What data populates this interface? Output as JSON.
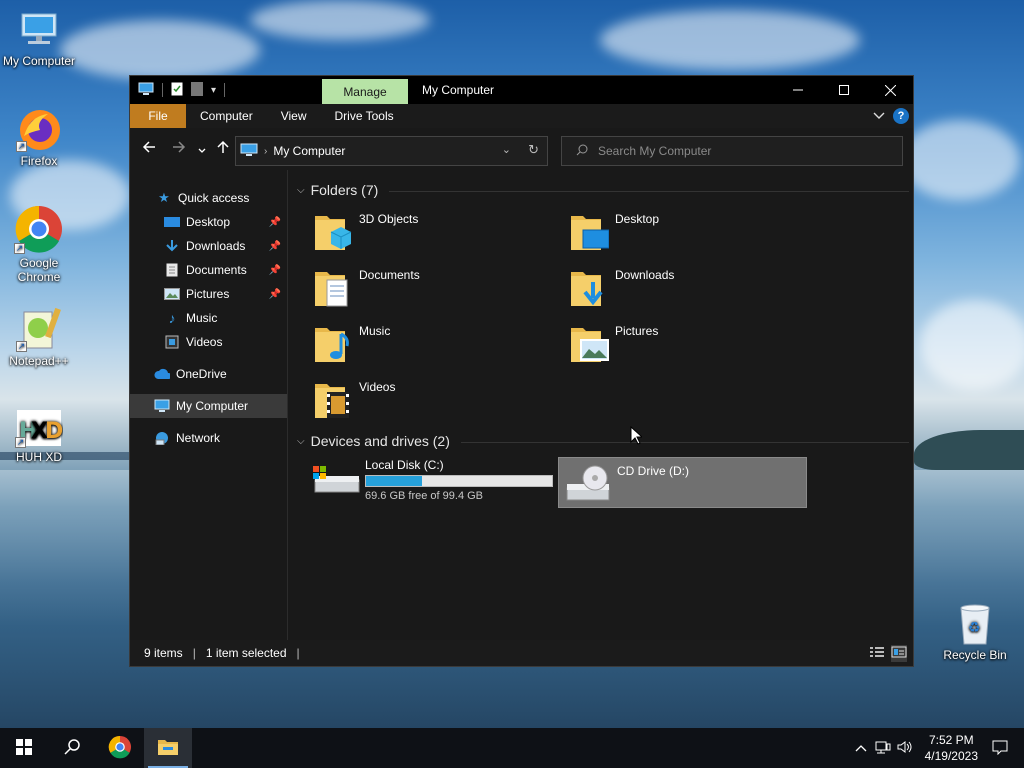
{
  "desktop": {
    "icons": [
      {
        "label": "My Computer"
      },
      {
        "label": "Firefox"
      },
      {
        "label": "Google Chrome"
      },
      {
        "label": "Notepad++"
      },
      {
        "label": "HUH XD"
      },
      {
        "label": "Recycle Bin"
      }
    ]
  },
  "window": {
    "title": "My Computer",
    "manage_tab": "Manage",
    "ribbon_tabs": [
      "File",
      "Computer",
      "View",
      "Drive Tools"
    ],
    "address": "My Computer",
    "search_placeholder": "Search My Computer",
    "controls": {
      "minimize": "—",
      "maximize": "☐",
      "close": "✕"
    }
  },
  "sidebar": {
    "items": [
      {
        "label": "Quick access",
        "icon": "star-icon"
      },
      {
        "label": "Desktop",
        "icon": "desktop-folder-icon",
        "pinned": true
      },
      {
        "label": "Downloads",
        "icon": "downloads-icon",
        "pinned": true
      },
      {
        "label": "Documents",
        "icon": "documents-icon",
        "pinned": true
      },
      {
        "label": "Pictures",
        "icon": "pictures-icon",
        "pinned": true
      },
      {
        "label": "Music",
        "icon": "music-icon"
      },
      {
        "label": "Videos",
        "icon": "videos-icon"
      },
      {
        "label": "OneDrive",
        "icon": "cloud-icon"
      },
      {
        "label": "My Computer",
        "icon": "computer-icon",
        "selected": true
      },
      {
        "label": "Network",
        "icon": "network-icon"
      }
    ]
  },
  "content": {
    "folders_header": "Folders (7)",
    "folders": [
      {
        "label": "3D Objects"
      },
      {
        "label": "Desktop"
      },
      {
        "label": "Documents"
      },
      {
        "label": "Downloads"
      },
      {
        "label": "Music"
      },
      {
        "label": "Pictures"
      },
      {
        "label": "Videos"
      }
    ],
    "devices_header": "Devices and drives (2)",
    "drives": [
      {
        "label": "Local Disk (C:)",
        "free_text": "69.6 GB free of 99.4 GB",
        "used_fraction": 0.3
      },
      {
        "label": "CD Drive (D:)"
      }
    ]
  },
  "status": {
    "items": "9 items",
    "selected": "1 item selected"
  },
  "taskbar": {
    "time": "7:52 PM",
    "date": "4/19/2023"
  },
  "colors": {
    "accent": "#26a0da",
    "file_tab": "#c07c1f",
    "manage_tab": "#b7e3a6"
  }
}
